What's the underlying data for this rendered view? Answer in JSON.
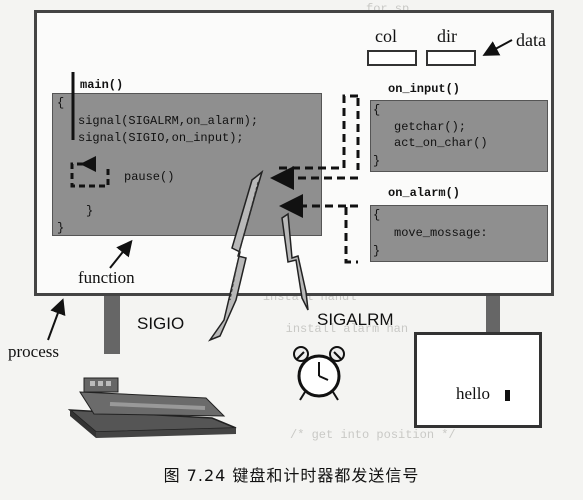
{
  "labels": {
    "col": "col",
    "dir": "dir",
    "data": "data",
    "function": "function",
    "process": "process",
    "sigio": "SIGIO",
    "sigalrm": "SIGALRM",
    "hello": "hello"
  },
  "main_block": {
    "header": "main()",
    "open_brace": "{",
    "line1": "signal(SIGALRM,on_alarm);",
    "line2": "signal(SIGIO,on_input);",
    "pause": "pause()",
    "inner_close": "}",
    "close_brace": "}"
  },
  "on_input": {
    "header": "on_input()",
    "open_brace": "{",
    "line1": "getchar();",
    "line2": "act_on_char()",
    "close_brace": "}"
  },
  "on_alarm": {
    "header": "on_alarm()",
    "open_brace": "{",
    "line1": "move_mossage:",
    "close_brace": "}"
  },
  "caption": "图 7.24   键盘和计时器都发送信号"
}
